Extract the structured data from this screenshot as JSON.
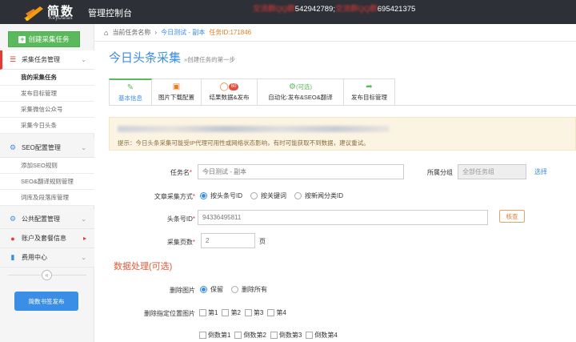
{
  "header": {
    "logo_title": "简数",
    "logo_sub": "KeyDatas",
    "app_title": "管理控制台",
    "contact_blur_1": "交流群QQ群",
    "contact_num_1": "542942789;",
    "contact_blur_2": "交流群QQ群",
    "contact_num_2": "695421375"
  },
  "sidebar": {
    "create_label": "创建采集任务",
    "groups": [
      {
        "label": "采集任务管理",
        "icon": "list-icon"
      },
      {
        "label": "SEO配置管理",
        "icon": "gear-icon"
      },
      {
        "label": "公共配置管理",
        "icon": "gears-icon"
      },
      {
        "label": "账户及套餐信息",
        "icon": "user-icon"
      },
      {
        "label": "费用中心",
        "icon": "bar-chart-icon"
      }
    ],
    "task_items": [
      "我的采集任务",
      "发布目标管理",
      "采集微信公众号",
      "采集今日头条"
    ],
    "seo_items": [
      "添加SEO规则",
      "SEO&翻译规则管理",
      "词库及段落库管理"
    ],
    "publish_label": "简数书签发布"
  },
  "breadcrumb": {
    "prefix": "当前任务名称",
    "task_name": "今日测试 - 副本",
    "task_id": "任务ID:171846"
  },
  "page": {
    "title": "今日头条采集",
    "subtitle": "»创建任务的第一步"
  },
  "tabs": [
    {
      "label": "基本信息",
      "icon": "edit-icon"
    },
    {
      "label": "图片下载配置",
      "icon": "image-icon"
    },
    {
      "label": "结果数据&发布",
      "icon": "database-icon",
      "badge": "60"
    },
    {
      "label": "自动化:发布&SEO&翻译",
      "icon": "gears-icon",
      "extra": "(可选)"
    },
    {
      "label": "发布目标管理",
      "icon": "share-icon"
    }
  ],
  "notice": {
    "text": "提示：今日头条采集可能受IP代理可用性或网络状态影响，有时可能获取不到数据，建议重试。"
  },
  "form": {
    "task_name_label": "任务名",
    "task_name_value": "今日测试 - 副本",
    "group_label": "所属分组",
    "group_value": "全部任务组",
    "group_select": "选择",
    "method_label": "文章采集方式",
    "methods": [
      "按头条号ID",
      "按关键词",
      "按新闻分类ID"
    ],
    "toutiao_id_label": "头条号ID",
    "toutiao_id_value": "94336495811",
    "check_label": "核查",
    "pages_label": "采集页数",
    "pages_value": "2",
    "pages_unit": "页"
  },
  "data_section": {
    "title": "数据处理(可选)",
    "delete_img_label": "删除图片",
    "delete_img_options": [
      "保留",
      "删除所有"
    ],
    "delete_pos_label": "删除指定位置图片",
    "positions": [
      "第1",
      "第2",
      "第3",
      "第4"
    ],
    "reverse_positions": [
      "倒数第1",
      "倒数第2",
      "倒数第3",
      "倒数第4"
    ]
  },
  "colors": {
    "topbar": "#2d3037",
    "accent_blue": "#3a8ee6",
    "green": "#5cb85c",
    "required_red": "#e53935"
  }
}
